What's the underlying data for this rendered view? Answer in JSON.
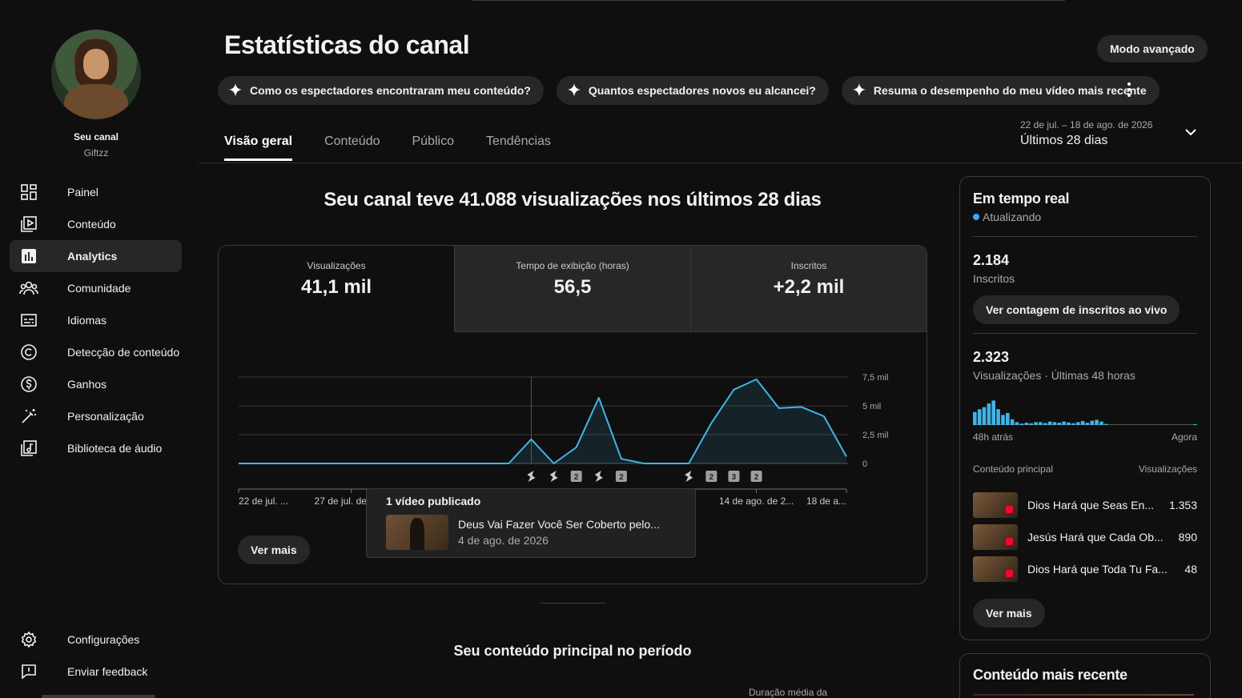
{
  "sidebar": {
    "channel_label": "Seu canal",
    "channel_handle": "Giftzz",
    "items": [
      {
        "label": "Painel",
        "icon": "dashboard-icon"
      },
      {
        "label": "Conteúdo",
        "icon": "content-icon"
      },
      {
        "label": "Analytics",
        "icon": "analytics-icon",
        "active": true
      },
      {
        "label": "Comunidade",
        "icon": "community-icon"
      },
      {
        "label": "Idiomas",
        "icon": "subtitles-icon"
      },
      {
        "label": "Detecção de conteúdo",
        "icon": "copyright-icon"
      },
      {
        "label": "Ganhos",
        "icon": "dollar-icon"
      },
      {
        "label": "Personalização",
        "icon": "magic-wand-icon"
      },
      {
        "label": "Biblioteca de áudio",
        "icon": "audio-library-icon"
      }
    ],
    "bottom_items": [
      {
        "label": "Configurações",
        "icon": "gear-icon"
      },
      {
        "label": "Enviar feedback",
        "icon": "feedback-icon"
      }
    ]
  },
  "header": {
    "title": "Estatísticas do canal",
    "advanced_mode": "Modo avançado",
    "chips": [
      "Como os espectadores encontraram meu conteúdo?",
      "Quantos espectadores novos eu alcancei?",
      "Resuma o desempenho do meu vídeo mais recente"
    ]
  },
  "tabs": [
    "Visão geral",
    "Conteúdo",
    "Público",
    "Tendências"
  ],
  "date_range": {
    "sub": "22 de jul. – 18 de ago. de 2026",
    "main": "Últimos 28 dias"
  },
  "headline": "Seu canal teve 41.088 visualizações nos últimos 28 dias",
  "metrics": [
    {
      "label": "Visualizações",
      "value": "41,1 mil"
    },
    {
      "label": "Tempo de exibição (horas)",
      "value": "56,5"
    },
    {
      "label": "Inscritos",
      "value": "+2,2 mil"
    }
  ],
  "chart_data": {
    "type": "area",
    "x_tick_labels": [
      "22 de jul. ...",
      "27 de jul. de",
      "14 de ago. de 2...",
      "18 de a..."
    ],
    "y_tick_labels": [
      "0",
      "2,5 mil",
      "5 mil",
      "7,5 mil"
    ],
    "ylim": [
      0,
      7500
    ],
    "day_index": [
      0,
      1,
      2,
      3,
      4,
      5,
      6,
      7,
      8,
      9,
      10,
      11,
      12,
      13,
      14,
      15,
      16,
      17,
      18,
      19,
      20,
      21,
      22,
      23,
      24,
      25,
      26,
      27
    ],
    "values": [
      0,
      0,
      0,
      0,
      0,
      0,
      0,
      0,
      0,
      0,
      0,
      0,
      0,
      2100,
      0,
      1400,
      5700,
      400,
      0,
      0,
      0,
      3500,
      6400,
      7300,
      4800,
      4900,
      4100,
      600
    ],
    "publish_markers": [
      {
        "day": 13,
        "label": ""
      },
      {
        "day": 14,
        "label": ""
      },
      {
        "day": 15,
        "label": "2"
      },
      {
        "day": 16,
        "label": ""
      },
      {
        "day": 17,
        "label": "2"
      },
      {
        "day": 20,
        "label": ""
      },
      {
        "day": 21,
        "label": "2"
      },
      {
        "day": 22,
        "label": "3"
      },
      {
        "day": 23,
        "label": "2"
      }
    ],
    "hover_day": 13,
    "line_color": "#41b4e6",
    "grid": true
  },
  "see_more": "Ver mais",
  "tooltip": {
    "title": "1 vídeo publicado",
    "video_title": "Deus Vai Fazer Você Ser Coberto pelo...",
    "video_date": "4 de ago. de 2026"
  },
  "top_content_section": "Seu conteúdo principal no período",
  "avg_duration_label": "Duração média da",
  "realtime": {
    "title": "Em tempo real",
    "status": "Atualizando",
    "subscribers_value": "2.184",
    "subscribers_label": "Inscritos",
    "live_count_button": "Ver contagem de inscritos ao vivo",
    "views_value": "2.323",
    "views_label": "Visualizações · Últimas 48 horas",
    "bars": [
      0.45,
      0.55,
      0.62,
      0.75,
      0.85,
      0.55,
      0.35,
      0.42,
      0.2,
      0.1,
      0.05,
      0.08,
      0.06,
      0.1,
      0.1,
      0.07,
      0.12,
      0.1,
      0.08,
      0.12,
      0.09,
      0.06,
      0.1,
      0.14,
      0.08,
      0.15,
      0.18,
      0.12,
      0.04,
      0,
      0,
      0,
      0,
      0,
      0,
      0,
      0,
      0,
      0,
      0,
      0,
      0,
      0,
      0,
      0,
      0,
      0,
      0.02
    ],
    "axis_left": "48h atrás",
    "axis_right": "Agora",
    "content_header_left": "Conteúdo principal",
    "content_header_right": "Visualizações",
    "top_content": [
      {
        "title": "Dios Hará que Seas En...",
        "views": "1.353"
      },
      {
        "title": "Jesús Hará que Cada Ob...",
        "views": "890"
      },
      {
        "title": "Dios Hará que Toda Tu Fa...",
        "views": "48"
      }
    ],
    "see_more": "Ver mais"
  },
  "recent": {
    "title": "Conteúdo mais recente"
  }
}
